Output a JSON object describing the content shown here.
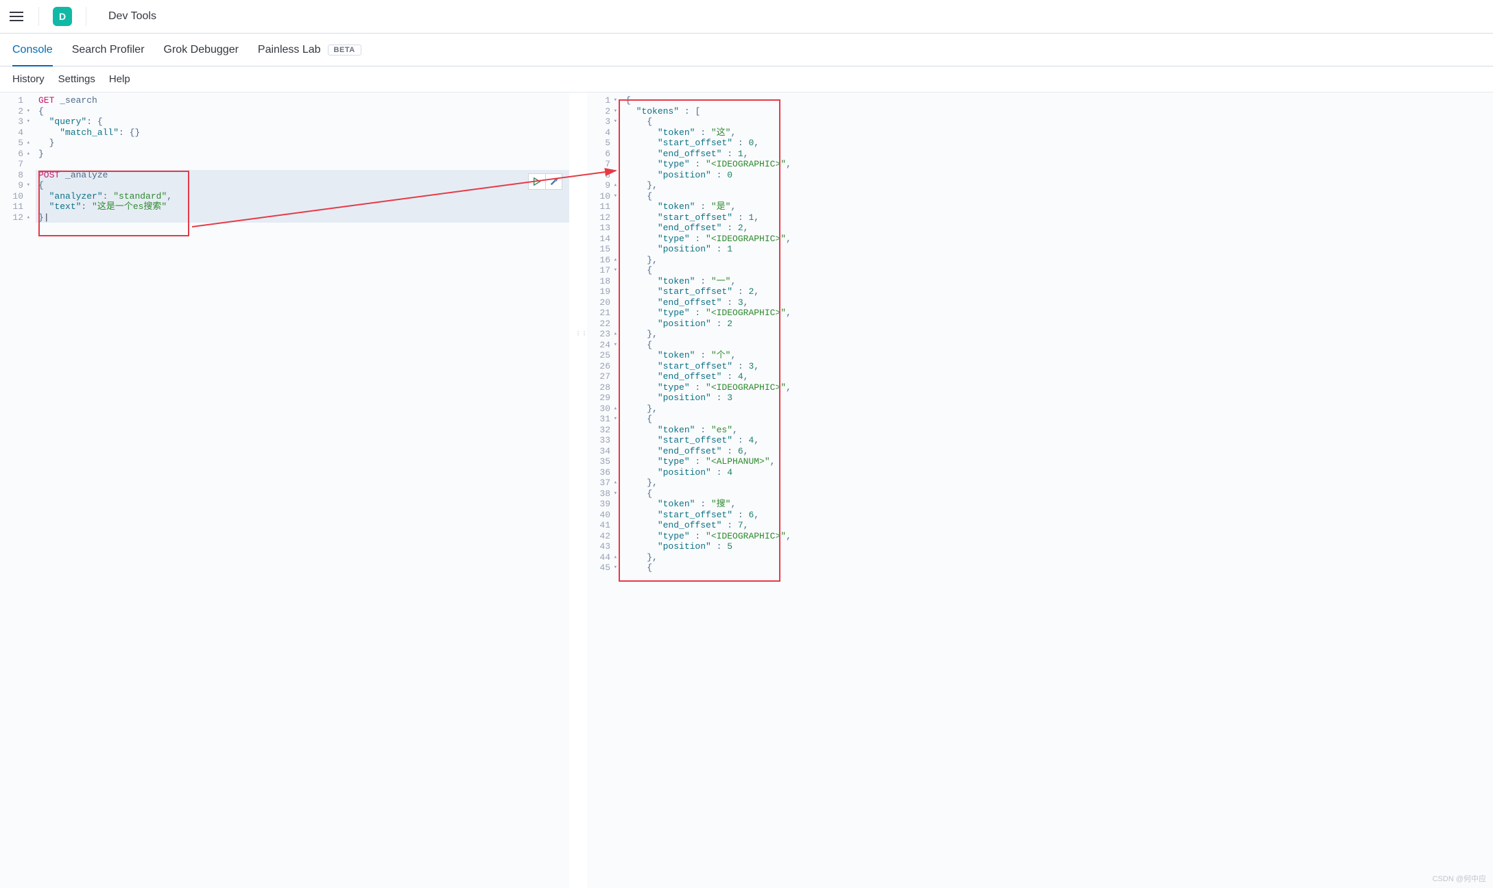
{
  "header": {
    "app_icon_letter": "D",
    "title": "Dev Tools"
  },
  "tabs": [
    {
      "label": "Console",
      "active": true
    },
    {
      "label": "Search Profiler",
      "active": false
    },
    {
      "label": "Grok Debugger",
      "active": false
    },
    {
      "label": "Painless Lab",
      "active": false,
      "badge": "BETA"
    }
  ],
  "subnav": [
    {
      "label": "History"
    },
    {
      "label": "Settings"
    },
    {
      "label": "Help"
    }
  ],
  "request_editor": {
    "highlight_start_line": 8,
    "highlight_end_line": 12,
    "lines": [
      {
        "n": 1,
        "fold": "",
        "tokens": [
          [
            "method",
            "GET"
          ],
          [
            "space",
            " "
          ],
          [
            "path",
            "_search"
          ]
        ]
      },
      {
        "n": 2,
        "fold": "▾",
        "tokens": [
          [
            "punc",
            "{"
          ]
        ]
      },
      {
        "n": 3,
        "fold": "▾",
        "tokens": [
          [
            "space",
            "  "
          ],
          [
            "key",
            "\"query\""
          ],
          [
            "colon",
            ": "
          ],
          [
            "punc",
            "{"
          ]
        ]
      },
      {
        "n": 4,
        "fold": "",
        "tokens": [
          [
            "space",
            "    "
          ],
          [
            "key",
            "\"match_all\""
          ],
          [
            "colon",
            ": "
          ],
          [
            "punc",
            "{}"
          ]
        ]
      },
      {
        "n": 5,
        "fold": "▴",
        "tokens": [
          [
            "space",
            "  "
          ],
          [
            "punc",
            "}"
          ]
        ]
      },
      {
        "n": 6,
        "fold": "▴",
        "tokens": [
          [
            "punc",
            "}"
          ]
        ]
      },
      {
        "n": 7,
        "fold": "",
        "tokens": []
      },
      {
        "n": 8,
        "fold": "",
        "tokens": [
          [
            "method",
            "POST"
          ],
          [
            "space",
            " "
          ],
          [
            "path",
            "_analyze"
          ]
        ]
      },
      {
        "n": 9,
        "fold": "▾",
        "tokens": [
          [
            "punc",
            "{"
          ]
        ]
      },
      {
        "n": 10,
        "fold": "",
        "tokens": [
          [
            "space",
            "  "
          ],
          [
            "key",
            "\"analyzer\""
          ],
          [
            "colon",
            ": "
          ],
          [
            "str",
            "\"standard\""
          ],
          [
            "punc",
            ","
          ]
        ]
      },
      {
        "n": 11,
        "fold": "",
        "tokens": [
          [
            "space",
            "  "
          ],
          [
            "key",
            "\"text\""
          ],
          [
            "colon",
            ": "
          ],
          [
            "str",
            "\"这是一个es搜索\""
          ]
        ]
      },
      {
        "n": 12,
        "fold": "▴",
        "tokens": [
          [
            "punc",
            "}"
          ],
          [
            "cursor",
            "|"
          ]
        ]
      }
    ]
  },
  "response_editor": {
    "lines": [
      {
        "n": 1,
        "fold": "▾",
        "tokens": [
          [
            "punc",
            "{"
          ]
        ]
      },
      {
        "n": 2,
        "fold": "▾",
        "tokens": [
          [
            "space",
            "  "
          ],
          [
            "key",
            "\"tokens\""
          ],
          [
            "colon",
            " : "
          ],
          [
            "punc",
            "["
          ]
        ]
      },
      {
        "n": 3,
        "fold": "▾",
        "tokens": [
          [
            "space",
            "    "
          ],
          [
            "punc",
            "{"
          ]
        ]
      },
      {
        "n": 4,
        "fold": "",
        "tokens": [
          [
            "space",
            "      "
          ],
          [
            "key",
            "\"token\""
          ],
          [
            "colon",
            " : "
          ],
          [
            "str",
            "\"这\""
          ],
          [
            "punc",
            ","
          ]
        ]
      },
      {
        "n": 5,
        "fold": "",
        "tokens": [
          [
            "space",
            "      "
          ],
          [
            "key",
            "\"start_offset\""
          ],
          [
            "colon",
            " : "
          ],
          [
            "num",
            "0"
          ],
          [
            "punc",
            ","
          ]
        ]
      },
      {
        "n": 6,
        "fold": "",
        "tokens": [
          [
            "space",
            "      "
          ],
          [
            "key",
            "\"end_offset\""
          ],
          [
            "colon",
            " : "
          ],
          [
            "num",
            "1"
          ],
          [
            "punc",
            ","
          ]
        ]
      },
      {
        "n": 7,
        "fold": "",
        "tokens": [
          [
            "space",
            "      "
          ],
          [
            "key",
            "\"type\""
          ],
          [
            "colon",
            " : "
          ],
          [
            "str",
            "\"<IDEOGRAPHIC>\""
          ],
          [
            "punc",
            ","
          ]
        ]
      },
      {
        "n": 8,
        "fold": "",
        "tokens": [
          [
            "space",
            "      "
          ],
          [
            "key",
            "\"position\""
          ],
          [
            "colon",
            " : "
          ],
          [
            "num",
            "0"
          ]
        ]
      },
      {
        "n": 9,
        "fold": "▴",
        "tokens": [
          [
            "space",
            "    "
          ],
          [
            "punc",
            "},"
          ]
        ]
      },
      {
        "n": 10,
        "fold": "▾",
        "tokens": [
          [
            "space",
            "    "
          ],
          [
            "punc",
            "{"
          ]
        ]
      },
      {
        "n": 11,
        "fold": "",
        "tokens": [
          [
            "space",
            "      "
          ],
          [
            "key",
            "\"token\""
          ],
          [
            "colon",
            " : "
          ],
          [
            "str",
            "\"是\""
          ],
          [
            "punc",
            ","
          ]
        ]
      },
      {
        "n": 12,
        "fold": "",
        "tokens": [
          [
            "space",
            "      "
          ],
          [
            "key",
            "\"start_offset\""
          ],
          [
            "colon",
            " : "
          ],
          [
            "num",
            "1"
          ],
          [
            "punc",
            ","
          ]
        ]
      },
      {
        "n": 13,
        "fold": "",
        "tokens": [
          [
            "space",
            "      "
          ],
          [
            "key",
            "\"end_offset\""
          ],
          [
            "colon",
            " : "
          ],
          [
            "num",
            "2"
          ],
          [
            "punc",
            ","
          ]
        ]
      },
      {
        "n": 14,
        "fold": "",
        "tokens": [
          [
            "space",
            "      "
          ],
          [
            "key",
            "\"type\""
          ],
          [
            "colon",
            " : "
          ],
          [
            "str",
            "\"<IDEOGRAPHIC>\""
          ],
          [
            "punc",
            ","
          ]
        ]
      },
      {
        "n": 15,
        "fold": "",
        "tokens": [
          [
            "space",
            "      "
          ],
          [
            "key",
            "\"position\""
          ],
          [
            "colon",
            " : "
          ],
          [
            "num",
            "1"
          ]
        ]
      },
      {
        "n": 16,
        "fold": "▴",
        "tokens": [
          [
            "space",
            "    "
          ],
          [
            "punc",
            "},"
          ]
        ]
      },
      {
        "n": 17,
        "fold": "▾",
        "tokens": [
          [
            "space",
            "    "
          ],
          [
            "punc",
            "{"
          ]
        ]
      },
      {
        "n": 18,
        "fold": "",
        "tokens": [
          [
            "space",
            "      "
          ],
          [
            "key",
            "\"token\""
          ],
          [
            "colon",
            " : "
          ],
          [
            "str",
            "\"一\""
          ],
          [
            "punc",
            ","
          ]
        ]
      },
      {
        "n": 19,
        "fold": "",
        "tokens": [
          [
            "space",
            "      "
          ],
          [
            "key",
            "\"start_offset\""
          ],
          [
            "colon",
            " : "
          ],
          [
            "num",
            "2"
          ],
          [
            "punc",
            ","
          ]
        ]
      },
      {
        "n": 20,
        "fold": "",
        "tokens": [
          [
            "space",
            "      "
          ],
          [
            "key",
            "\"end_offset\""
          ],
          [
            "colon",
            " : "
          ],
          [
            "num",
            "3"
          ],
          [
            "punc",
            ","
          ]
        ]
      },
      {
        "n": 21,
        "fold": "",
        "tokens": [
          [
            "space",
            "      "
          ],
          [
            "key",
            "\"type\""
          ],
          [
            "colon",
            " : "
          ],
          [
            "str",
            "\"<IDEOGRAPHIC>\""
          ],
          [
            "punc",
            ","
          ]
        ]
      },
      {
        "n": 22,
        "fold": "",
        "tokens": [
          [
            "space",
            "      "
          ],
          [
            "key",
            "\"position\""
          ],
          [
            "colon",
            " : "
          ],
          [
            "num",
            "2"
          ]
        ]
      },
      {
        "n": 23,
        "fold": "▴",
        "tokens": [
          [
            "space",
            "    "
          ],
          [
            "punc",
            "},"
          ]
        ]
      },
      {
        "n": 24,
        "fold": "▾",
        "tokens": [
          [
            "space",
            "    "
          ],
          [
            "punc",
            "{"
          ]
        ]
      },
      {
        "n": 25,
        "fold": "",
        "tokens": [
          [
            "space",
            "      "
          ],
          [
            "key",
            "\"token\""
          ],
          [
            "colon",
            " : "
          ],
          [
            "str",
            "\"个\""
          ],
          [
            "punc",
            ","
          ]
        ]
      },
      {
        "n": 26,
        "fold": "",
        "tokens": [
          [
            "space",
            "      "
          ],
          [
            "key",
            "\"start_offset\""
          ],
          [
            "colon",
            " : "
          ],
          [
            "num",
            "3"
          ],
          [
            "punc",
            ","
          ]
        ]
      },
      {
        "n": 27,
        "fold": "",
        "tokens": [
          [
            "space",
            "      "
          ],
          [
            "key",
            "\"end_offset\""
          ],
          [
            "colon",
            " : "
          ],
          [
            "num",
            "4"
          ],
          [
            "punc",
            ","
          ]
        ]
      },
      {
        "n": 28,
        "fold": "",
        "tokens": [
          [
            "space",
            "      "
          ],
          [
            "key",
            "\"type\""
          ],
          [
            "colon",
            " : "
          ],
          [
            "str",
            "\"<IDEOGRAPHIC>\""
          ],
          [
            "punc",
            ","
          ]
        ]
      },
      {
        "n": 29,
        "fold": "",
        "tokens": [
          [
            "space",
            "      "
          ],
          [
            "key",
            "\"position\""
          ],
          [
            "colon",
            " : "
          ],
          [
            "num",
            "3"
          ]
        ]
      },
      {
        "n": 30,
        "fold": "▴",
        "tokens": [
          [
            "space",
            "    "
          ],
          [
            "punc",
            "},"
          ]
        ]
      },
      {
        "n": 31,
        "fold": "▾",
        "tokens": [
          [
            "space",
            "    "
          ],
          [
            "punc",
            "{"
          ]
        ]
      },
      {
        "n": 32,
        "fold": "",
        "tokens": [
          [
            "space",
            "      "
          ],
          [
            "key",
            "\"token\""
          ],
          [
            "colon",
            " : "
          ],
          [
            "str",
            "\"es\""
          ],
          [
            "punc",
            ","
          ]
        ]
      },
      {
        "n": 33,
        "fold": "",
        "tokens": [
          [
            "space",
            "      "
          ],
          [
            "key",
            "\"start_offset\""
          ],
          [
            "colon",
            " : "
          ],
          [
            "num",
            "4"
          ],
          [
            "punc",
            ","
          ]
        ]
      },
      {
        "n": 34,
        "fold": "",
        "tokens": [
          [
            "space",
            "      "
          ],
          [
            "key",
            "\"end_offset\""
          ],
          [
            "colon",
            " : "
          ],
          [
            "num",
            "6"
          ],
          [
            "punc",
            ","
          ]
        ]
      },
      {
        "n": 35,
        "fold": "",
        "tokens": [
          [
            "space",
            "      "
          ],
          [
            "key",
            "\"type\""
          ],
          [
            "colon",
            " : "
          ],
          [
            "str",
            "\"<ALPHANUM>\""
          ],
          [
            "punc",
            ","
          ]
        ]
      },
      {
        "n": 36,
        "fold": "",
        "tokens": [
          [
            "space",
            "      "
          ],
          [
            "key",
            "\"position\""
          ],
          [
            "colon",
            " : "
          ],
          [
            "num",
            "4"
          ]
        ]
      },
      {
        "n": 37,
        "fold": "▴",
        "tokens": [
          [
            "space",
            "    "
          ],
          [
            "punc",
            "},"
          ]
        ]
      },
      {
        "n": 38,
        "fold": "▾",
        "tokens": [
          [
            "space",
            "    "
          ],
          [
            "punc",
            "{"
          ]
        ]
      },
      {
        "n": 39,
        "fold": "",
        "tokens": [
          [
            "space",
            "      "
          ],
          [
            "key",
            "\"token\""
          ],
          [
            "colon",
            " : "
          ],
          [
            "str",
            "\"搜\""
          ],
          [
            "punc",
            ","
          ]
        ]
      },
      {
        "n": 40,
        "fold": "",
        "tokens": [
          [
            "space",
            "      "
          ],
          [
            "key",
            "\"start_offset\""
          ],
          [
            "colon",
            " : "
          ],
          [
            "num",
            "6"
          ],
          [
            "punc",
            ","
          ]
        ]
      },
      {
        "n": 41,
        "fold": "",
        "tokens": [
          [
            "space",
            "      "
          ],
          [
            "key",
            "\"end_offset\""
          ],
          [
            "colon",
            " : "
          ],
          [
            "num",
            "7"
          ],
          [
            "punc",
            ","
          ]
        ]
      },
      {
        "n": 42,
        "fold": "",
        "tokens": [
          [
            "space",
            "      "
          ],
          [
            "key",
            "\"type\""
          ],
          [
            "colon",
            " : "
          ],
          [
            "str",
            "\"<IDEOGRAPHIC>\""
          ],
          [
            "punc",
            ","
          ]
        ]
      },
      {
        "n": 43,
        "fold": "",
        "tokens": [
          [
            "space",
            "      "
          ],
          [
            "key",
            "\"position\""
          ],
          [
            "colon",
            " : "
          ],
          [
            "num",
            "5"
          ]
        ]
      },
      {
        "n": 44,
        "fold": "▴",
        "tokens": [
          [
            "space",
            "    "
          ],
          [
            "punc",
            "},"
          ]
        ]
      },
      {
        "n": 45,
        "fold": "▾",
        "tokens": [
          [
            "space",
            "    "
          ],
          [
            "punc",
            "{"
          ]
        ]
      }
    ]
  },
  "watermark": "CSDN @何中应"
}
